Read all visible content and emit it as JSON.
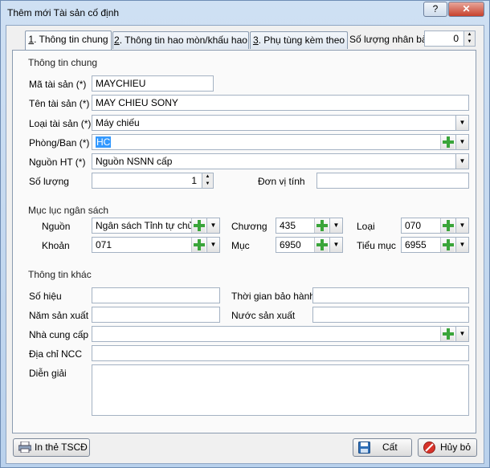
{
  "window": {
    "title": "Thêm mới Tài sản cố định",
    "help_label": "?",
    "close_label": "✕"
  },
  "tabs": [
    {
      "num": "1",
      "rest": ". Thông tin chung"
    },
    {
      "num": "2",
      "rest": ". Thông tin hao mòn/khấu hao"
    },
    {
      "num": "3",
      "rest": ". Phụ tùng kèm theo"
    }
  ],
  "copies": {
    "label": "Số lượng nhân bản",
    "value": "0"
  },
  "general": {
    "section": "Thông tin chung",
    "asset_code_label": "Mã tài sản (*)",
    "asset_code": "MAYCHIEU",
    "asset_name_label": "Tên tài sản (*)",
    "asset_name": "MAY CHIEU SONY",
    "asset_type_label": "Loại tài sản (*)",
    "asset_type": "Máy chiếu",
    "department_label": "Phòng/Ban (*)",
    "department": "HC",
    "source_label": "Nguồn HT (*)",
    "source": "Nguồn NSNN cấp",
    "quantity_label": "Số lượng",
    "quantity": "1",
    "unit_label": "Đơn vị tính",
    "unit": ""
  },
  "budget": {
    "section": "Mục lục ngân sách",
    "source_label": "Nguồn",
    "source": "Ngân sách Tỉnh tự chủ",
    "chapter_label": "Chương",
    "chapter": "435",
    "type_label": "Loại",
    "type": "070",
    "item_label": "Khoản",
    "item": "071",
    "section_label": "Mục",
    "section_value": "6950",
    "subsection_label": "Tiểu mục",
    "subsection": "6955"
  },
  "other": {
    "section": "Thông tin khác",
    "serial_label": "Số hiệu",
    "serial": "",
    "warranty_label": "Thời gian bảo hành",
    "warranty": "",
    "year_label": "Năm sản xuất",
    "year": "",
    "country_label": "Nước sản xuất",
    "country": "",
    "supplier_label": "Nhà cung cấp",
    "supplier": "",
    "supplier_addr_label": "Địa chỉ NCC",
    "supplier_addr": "",
    "notes_label": "Diễn giải",
    "notes": ""
  },
  "buttons": {
    "print": "In thẻ TSCĐ",
    "save": "Cất",
    "cancel": "Hủy bỏ"
  },
  "colors": {
    "plus_green": "#3aa53a",
    "selection": "#3399ff"
  }
}
